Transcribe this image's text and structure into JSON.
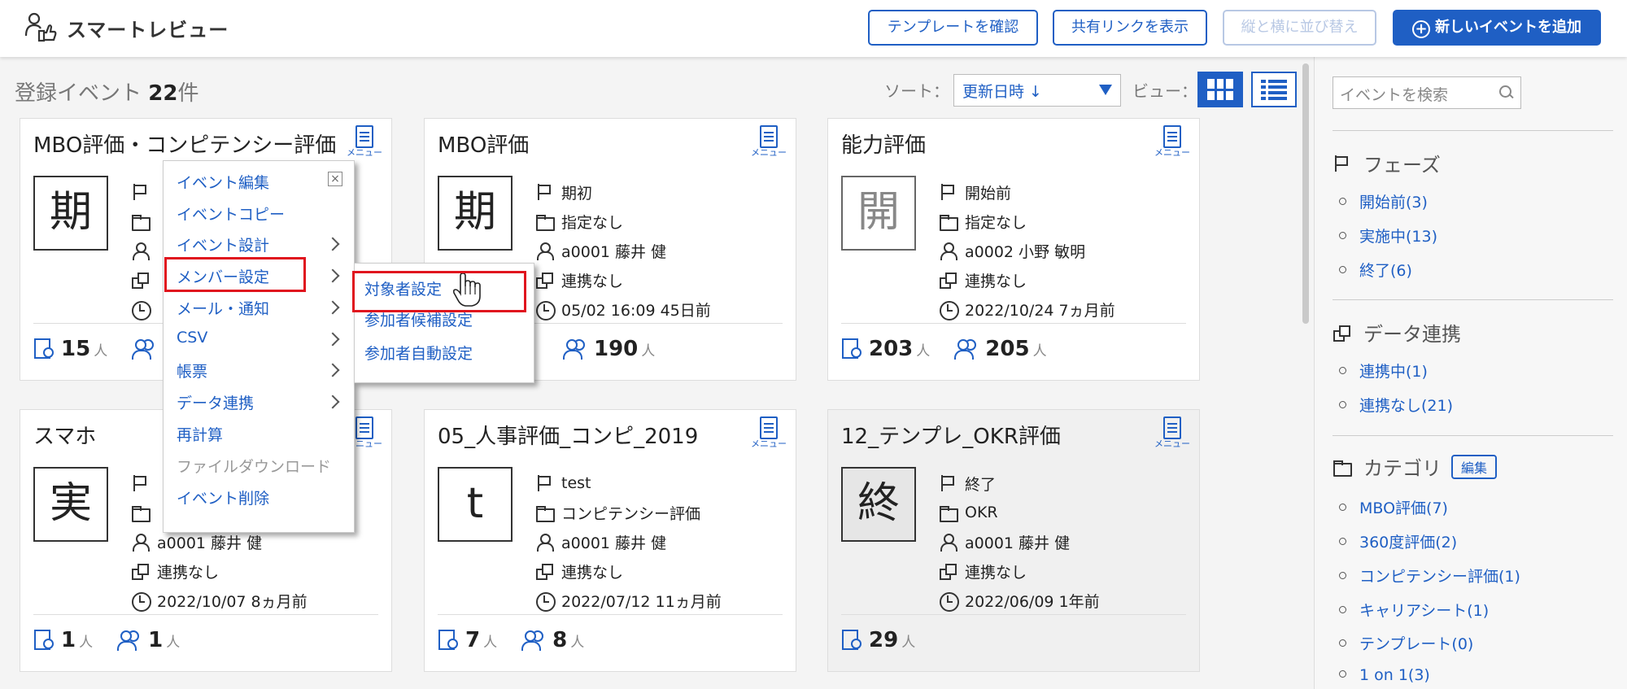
{
  "header": {
    "app_title": "スマートレビュー",
    "buttons": {
      "template": "テンプレートを確認",
      "share_link": "共有リンクを表示",
      "sort_layout": "縦と横に並び替え",
      "new_event": "新しいイベントを追加"
    }
  },
  "toolbar": {
    "count_prefix": "登録イベント",
    "count_value": "22",
    "count_unit": "件",
    "sort_label": "ソート：",
    "sort_value": "更新日時 ↓",
    "view_label": "ビュー："
  },
  "cards": [
    {
      "title": "MBO評価・コンピテンシー評価",
      "phase_char": "期",
      "phase": "",
      "category": "",
      "owner": "",
      "integration": "",
      "updated": "",
      "stat1": "15",
      "stat2": "",
      "menu_caption": "メニュー"
    },
    {
      "title": "MBO評価",
      "phase_char": "期",
      "phase": "期初",
      "category": "指定なし",
      "owner": "a0001 藤井 健",
      "integration": "連携なし",
      "updated": "05/02 16:09 45日前",
      "stat1": "",
      "stat2": "190",
      "menu_caption": "メニュー"
    },
    {
      "title": "能力評価",
      "phase_char": "開",
      "phase": "開始前",
      "category": "指定なし",
      "owner": "a0002 小野 敏明",
      "integration": "連携なし",
      "updated": "2022/10/24 7ヵ月前",
      "stat1": "203",
      "stat2": "205",
      "menu_caption": "メニュー"
    },
    {
      "title": "スマホ",
      "phase_char": "実",
      "phase": "",
      "category": "",
      "owner": "a0001 藤井 健",
      "integration": "連携なし",
      "updated": "2022/10/07 8ヵ月前",
      "stat1": "1",
      "stat2": "1",
      "menu_caption": "メニュー"
    },
    {
      "title": "05_人事評価_コンピ_2019",
      "phase_char": "t",
      "phase": "test",
      "category": "コンピテンシー評価",
      "owner": "a0001 藤井 健",
      "integration": "連携なし",
      "updated": "2022/07/12 11ヵ月前",
      "stat1": "7",
      "stat2": "8",
      "menu_caption": "メニュー"
    },
    {
      "title": "12_テンプレ_OKR評価",
      "phase_char": "終",
      "phase": "終了",
      "category": "OKR",
      "owner": "a0001 藤井 健",
      "integration": "連携なし",
      "updated": "2022/06/09 1年前",
      "stat1": "29",
      "stat2": "",
      "menu_caption": "メニュー"
    }
  ],
  "stat_unit": "人",
  "menu": {
    "items": [
      "イベント編集",
      "イベントコピー",
      "イベント設計",
      "メンバー設定",
      "メール・通知",
      "CSV",
      "帳票",
      "データ連携",
      "再計算",
      "ファイルダウンロード",
      "イベント削除"
    ],
    "submenu": [
      "対象者設定",
      "参加者候補設定",
      "参加者自動設定"
    ]
  },
  "sidebar": {
    "search_placeholder": "イベントを検索",
    "phase_title": "フェーズ",
    "phase_items": [
      "開始前(3)",
      "実施中(13)",
      "終了(6)"
    ],
    "integration_title": "データ連携",
    "integration_items": [
      "連携中(1)",
      "連携なし(21)"
    ],
    "category_title": "カテゴリ",
    "category_edit": "編集",
    "category_items": [
      "MBO評価(7)",
      "360度評価(2)",
      "コンピテンシー評価(1)",
      "キャリアシート(1)",
      "テンプレート(0)",
      "1 on 1(3)"
    ]
  },
  "colors": {
    "accent": "#1f5fc4",
    "highlight": "#e0141e"
  }
}
